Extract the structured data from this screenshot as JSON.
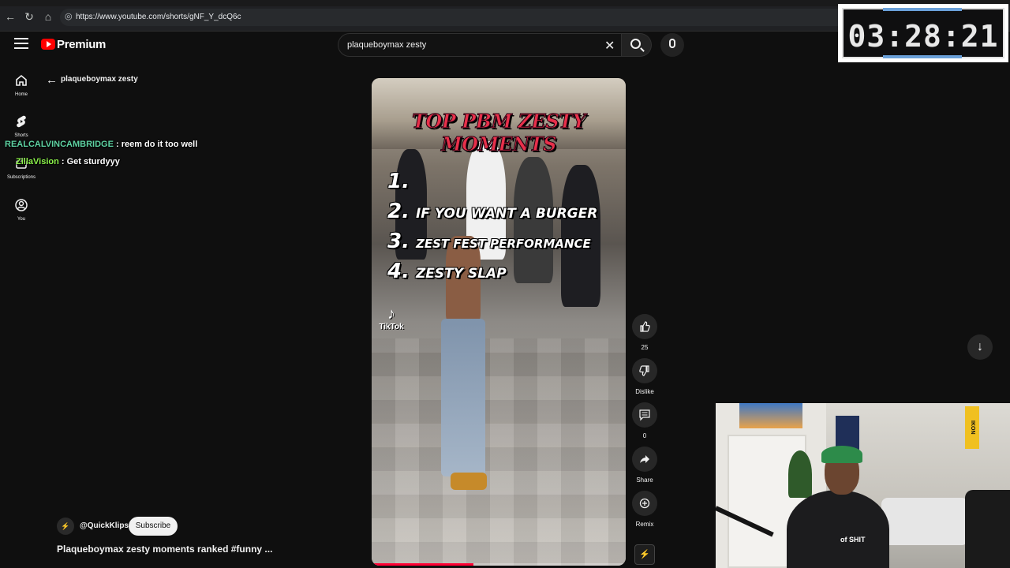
{
  "browser": {
    "url": "https://www.youtube.com/shorts/gNF_Y_dcQ6c"
  },
  "timer": {
    "text": "03:28:21"
  },
  "header": {
    "brand": "Premium",
    "search_value": "plaqueboymax zesty"
  },
  "sidebar": {
    "items": [
      {
        "label": "Home",
        "icon": "home-icon"
      },
      {
        "label": "Shorts",
        "icon": "shorts-icon"
      },
      {
        "label": "Subscriptions",
        "icon": "subscriptions-icon"
      },
      {
        "label": "You",
        "icon": "you-icon"
      }
    ]
  },
  "page": {
    "back_title": "plaqueboymax zesty"
  },
  "chat": [
    {
      "user": "REALCALVINCAMBRIDGE",
      "message": ": reem do it too well"
    },
    {
      "user": "ZillaVision",
      "message": ": Get sturdyyy"
    }
  ],
  "video": {
    "overlay_title": "TOP PBM ZESTY MOMENTS",
    "list": [
      {
        "num": "1.",
        "text": ""
      },
      {
        "num": "2.",
        "text": "IF YOU WANT A BURGER"
      },
      {
        "num": "3.",
        "text": "ZEST FEST PERFORMANCE"
      },
      {
        "num": "4.",
        "text": "ZESTY SLAP"
      }
    ],
    "watermark": "TikTok",
    "progress": 0.4
  },
  "actions": {
    "like_count": "25",
    "dislike_label": "Dislike",
    "comment_count": "0",
    "share_label": "Share",
    "remix_label": "Remix"
  },
  "channel": {
    "handle": "@QuickKlips.",
    "subscribe_label": "Subscribe",
    "video_title": "Plaqueboymax zesty moments ranked #funny ..."
  },
  "webcam": {
    "sign_text": "IKON",
    "shirt_text": "of SHIT"
  },
  "colors": {
    "youtube_red": "#ff0000",
    "chat_user1": "#5fd3a3",
    "chat_user2": "#8cf34a",
    "background": "#0f0f0f"
  }
}
